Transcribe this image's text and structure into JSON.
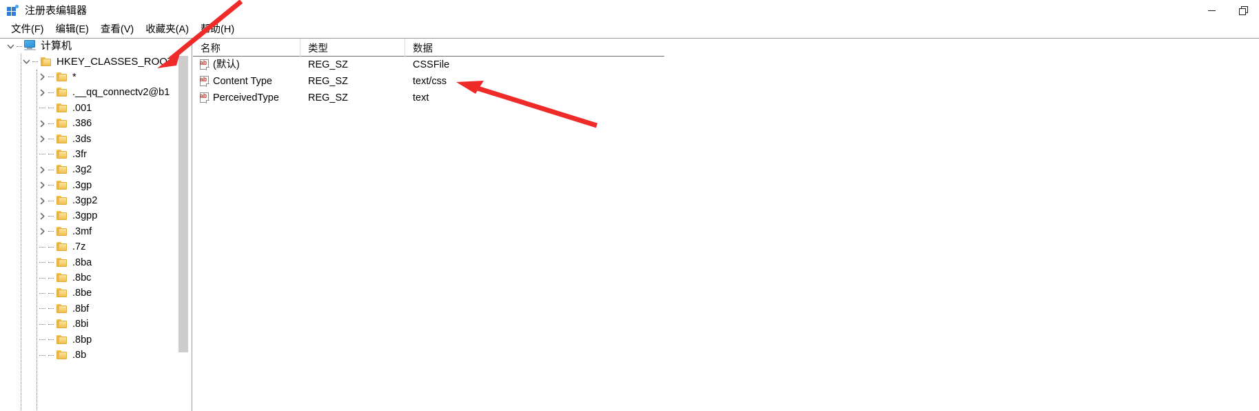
{
  "window": {
    "title": "注册表编辑器",
    "icon": "registry-editor-icon",
    "controls": {
      "minimize": "—",
      "maximize": "❐"
    }
  },
  "menubar": {
    "items": [
      {
        "label": "文件(F)",
        "name": "menu-file"
      },
      {
        "label": "编辑(E)",
        "name": "menu-edit"
      },
      {
        "label": "查看(V)",
        "name": "menu-view"
      },
      {
        "label": "收藏夹(A)",
        "name": "menu-favorites"
      },
      {
        "label": "帮助(H)",
        "name": "menu-help"
      }
    ]
  },
  "tree": {
    "root": {
      "label": "计算机",
      "icon": "computer-icon",
      "expanded": true
    },
    "items": [
      {
        "label": "HKEY_CLASSES_ROOT",
        "depth": 1,
        "expanded": true,
        "hasChildren": true
      },
      {
        "label": "*",
        "depth": 2,
        "expanded": false,
        "hasChildren": true
      },
      {
        "label": ".__qq_connectv2@b1",
        "depth": 2,
        "expanded": false,
        "hasChildren": true
      },
      {
        "label": ".001",
        "depth": 2,
        "expanded": false,
        "hasChildren": false
      },
      {
        "label": ".386",
        "depth": 2,
        "expanded": false,
        "hasChildren": true
      },
      {
        "label": ".3ds",
        "depth": 2,
        "expanded": false,
        "hasChildren": true
      },
      {
        "label": ".3fr",
        "depth": 2,
        "expanded": false,
        "hasChildren": false
      },
      {
        "label": ".3g2",
        "depth": 2,
        "expanded": false,
        "hasChildren": true
      },
      {
        "label": ".3gp",
        "depth": 2,
        "expanded": false,
        "hasChildren": true
      },
      {
        "label": ".3gp2",
        "depth": 2,
        "expanded": false,
        "hasChildren": true
      },
      {
        "label": ".3gpp",
        "depth": 2,
        "expanded": false,
        "hasChildren": true
      },
      {
        "label": ".3mf",
        "depth": 2,
        "expanded": false,
        "hasChildren": true
      },
      {
        "label": ".7z",
        "depth": 2,
        "expanded": false,
        "hasChildren": false
      },
      {
        "label": ".8ba",
        "depth": 2,
        "expanded": false,
        "hasChildren": false
      },
      {
        "label": ".8bc",
        "depth": 2,
        "expanded": false,
        "hasChildren": false
      },
      {
        "label": ".8be",
        "depth": 2,
        "expanded": false,
        "hasChildren": false
      },
      {
        "label": ".8bf",
        "depth": 2,
        "expanded": false,
        "hasChildren": false
      },
      {
        "label": ".8bi",
        "depth": 2,
        "expanded": false,
        "hasChildren": false
      },
      {
        "label": ".8bp",
        "depth": 2,
        "expanded": false,
        "hasChildren": false
      },
      {
        "label": ".8b",
        "depth": 2,
        "expanded": false,
        "hasChildren": false
      }
    ]
  },
  "list": {
    "columns": [
      {
        "label": "名称",
        "name": "column-name"
      },
      {
        "label": "类型",
        "name": "column-type"
      },
      {
        "label": "数据",
        "name": "column-data"
      }
    ],
    "rows": [
      {
        "name": "(默认)",
        "type": "REG_SZ",
        "data": "CSSFile",
        "icon": "string-value-icon"
      },
      {
        "name": "Content Type",
        "type": "REG_SZ",
        "data": "text/css",
        "icon": "string-value-icon"
      },
      {
        "name": "PerceivedType",
        "type": "REG_SZ",
        "data": "text",
        "icon": "string-value-icon"
      }
    ]
  },
  "annotations": {
    "color": "#ee2b28",
    "arrows": [
      {
        "name": "arrow-to-hkey-classes-root",
        "target": "HKEY_CLASSES_ROOT"
      },
      {
        "name": "arrow-to-text-css-value",
        "target": "text/css"
      }
    ]
  }
}
